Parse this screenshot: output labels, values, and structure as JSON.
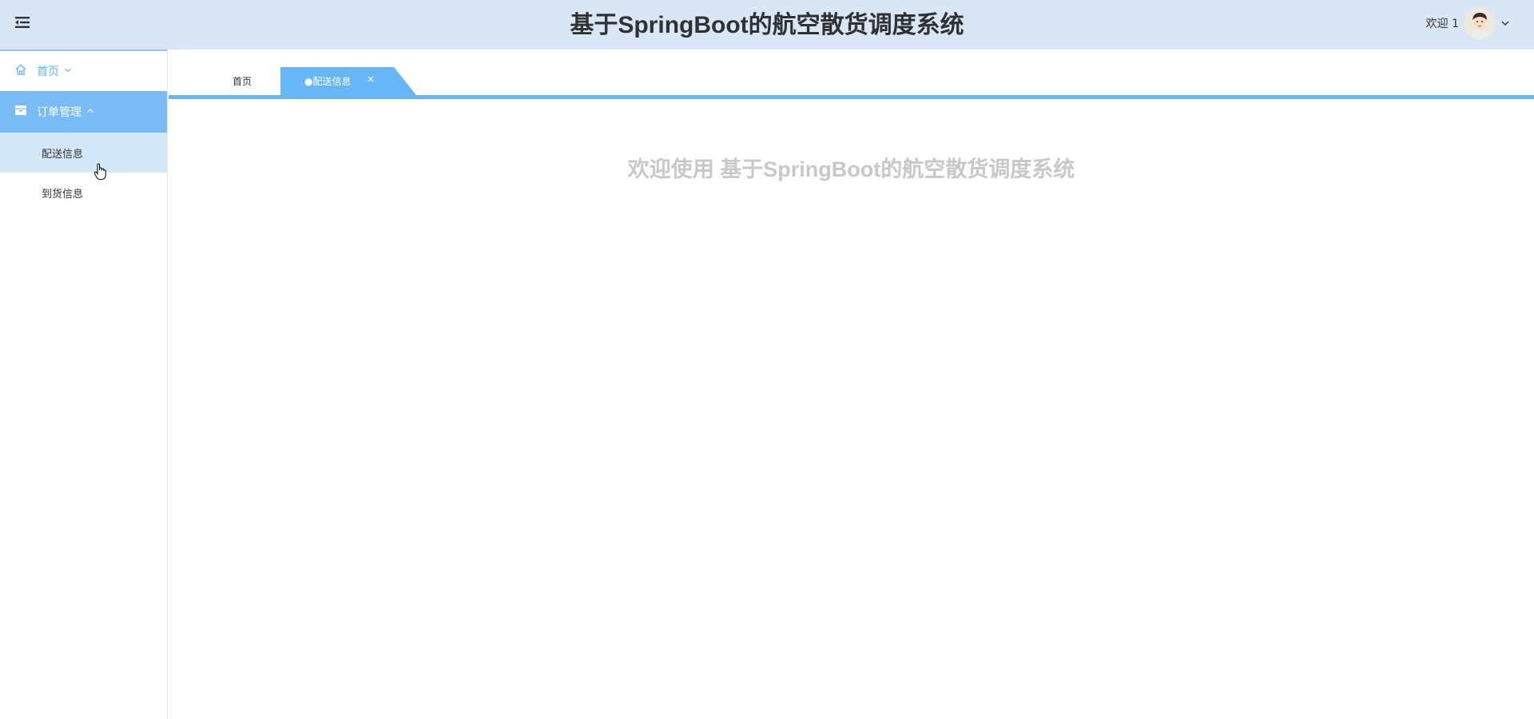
{
  "header": {
    "title": "基于SpringBoot的航空散货调度系统",
    "welcome": "欢迎 1",
    "accent_color": "#d9e6f6"
  },
  "sidebar": {
    "items": [
      {
        "label": "首页",
        "icon": "home-icon"
      },
      {
        "label": "订单管理",
        "icon": "archive-icon",
        "children": [
          {
            "label": "配送信息"
          },
          {
            "label": "到货信息"
          }
        ]
      }
    ],
    "active_color": "#79bbf5"
  },
  "tabs": [
    {
      "label": "首页"
    },
    {
      "label": "●配送信息",
      "close": "×"
    }
  ],
  "main": {
    "welcome_text": "欢迎使用 基于SpringBoot的航空散货调度系统"
  }
}
